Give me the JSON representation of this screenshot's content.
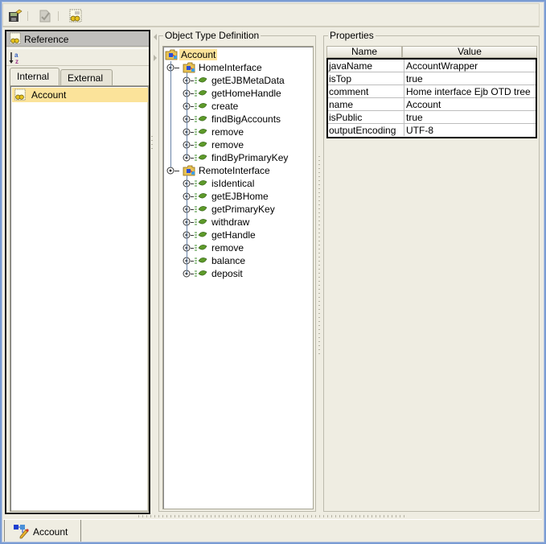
{
  "toolbar": {
    "buttons": [
      {
        "name": "save-icon",
        "enabled": true
      },
      {
        "name": "check-document-icon",
        "enabled": false
      },
      {
        "name": "reference-icon",
        "enabled": true
      }
    ]
  },
  "left_panel": {
    "header": "Reference",
    "sort_icon": "sort-az-icon",
    "tabs": [
      {
        "label": "Internal",
        "active": true
      },
      {
        "label": "External",
        "active": false
      }
    ],
    "items": [
      {
        "label": "Account",
        "selected": true
      }
    ]
  },
  "otd": {
    "title": "Object Type Definition",
    "root": "Account",
    "groups": [
      {
        "label": "HomeInterface",
        "methods": [
          "getEJBMetaData",
          "getHomeHandle",
          "create",
          "findBigAccounts",
          "remove",
          "remove",
          "findByPrimaryKey"
        ]
      },
      {
        "label": "RemoteInterface",
        "methods": [
          "isIdentical",
          "getEJBHome",
          "getPrimaryKey",
          "withdraw",
          "getHandle",
          "remove",
          "balance",
          "deposit"
        ]
      }
    ]
  },
  "properties": {
    "title": "Properties",
    "columns": [
      "Name",
      "Value"
    ],
    "rows": [
      [
        "javaName",
        "AccountWrapper"
      ],
      [
        "isTop",
        "true"
      ],
      [
        "comment",
        "Home interface Ejb OTD tree"
      ],
      [
        "name",
        "Account"
      ],
      [
        "isPublic",
        "true"
      ],
      [
        "outputEncoding",
        "UTF-8"
      ]
    ]
  },
  "bottom_tabs": [
    {
      "label": "Account",
      "active": true
    }
  ],
  "colors": {
    "selection": "#fbe39a",
    "panel_bg": "#efede2",
    "window_border": "#7a9cd3",
    "method_icon": "#5e9a2a"
  }
}
